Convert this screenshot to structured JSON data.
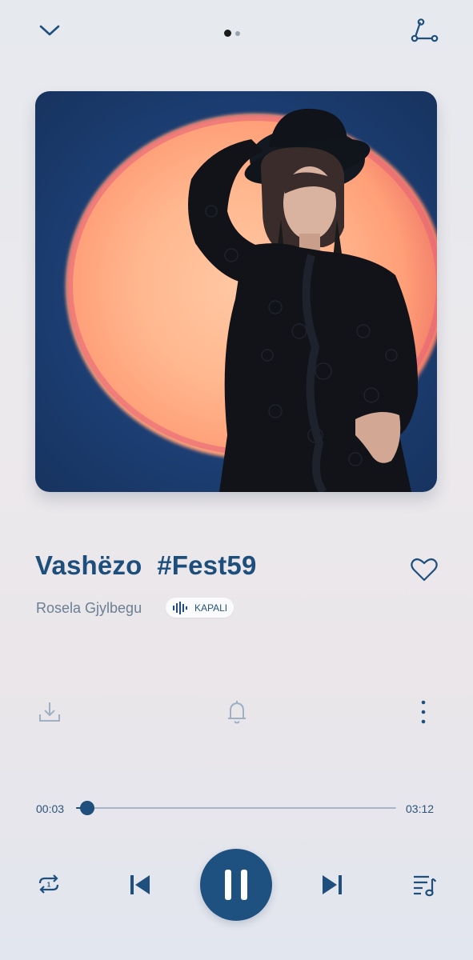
{
  "top_bar": {
    "collapse_icon": "chevron-down-icon",
    "pager": {
      "pages": 2,
      "current": 1
    },
    "share_icon": "share-icon"
  },
  "artwork": {
    "description_icon": "album-art"
  },
  "track": {
    "title": "Vashëzo  #Fest59",
    "artist": "Rosela Gjylbegu",
    "badge_label": "KAPALI",
    "liked": false
  },
  "actions": {
    "download_icon": "download-icon",
    "bell_icon": "bell-icon",
    "more_icon": "more-vertical-icon"
  },
  "progress": {
    "elapsed": "00:03",
    "total": "03:12",
    "fraction": 0.036
  },
  "controls": {
    "repeat_icon": "repeat-one-icon",
    "prev_icon": "skip-previous-icon",
    "play_state": "playing",
    "next_icon": "skip-next-icon",
    "queue_icon": "queue-music-icon"
  },
  "colors": {
    "accent": "#1e5080",
    "text_secondary": "#6a7f92",
    "track_bg": "#a7b6c6"
  }
}
